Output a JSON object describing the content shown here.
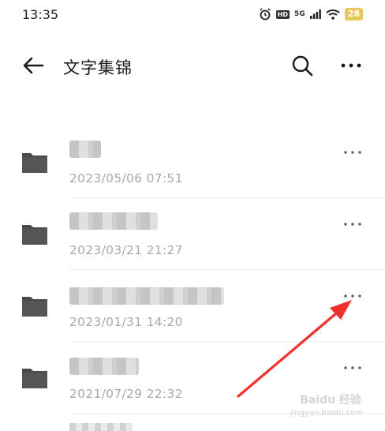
{
  "status_bar": {
    "time": "13:35",
    "network": "5G",
    "hd": "HD",
    "battery": "28",
    "icons": [
      "alarm-icon",
      "hd-icon",
      "signal-icon",
      "wifi-icon",
      "battery-icon"
    ]
  },
  "app_bar": {
    "title": "文字集锦",
    "icons": [
      "back-arrow-icon",
      "search-icon",
      "more-icon"
    ]
  },
  "folders": [
    {
      "name": "",
      "date": "2023/05/06 07:51"
    },
    {
      "name": "",
      "date": "2023/03/21 21:27"
    },
    {
      "name": "",
      "date": "2023/01/31 14:20"
    },
    {
      "name": "",
      "date": "2021/07/29 22:32"
    }
  ],
  "annotation": {
    "color": "#f0302a"
  },
  "watermark": {
    "text": "Baidu 经验",
    "url": "jingyan.baidu.com"
  },
  "colors": {
    "folder": "#4a4a4a",
    "date": "#a9a9a9",
    "accent_battery": "#e8c85a"
  }
}
